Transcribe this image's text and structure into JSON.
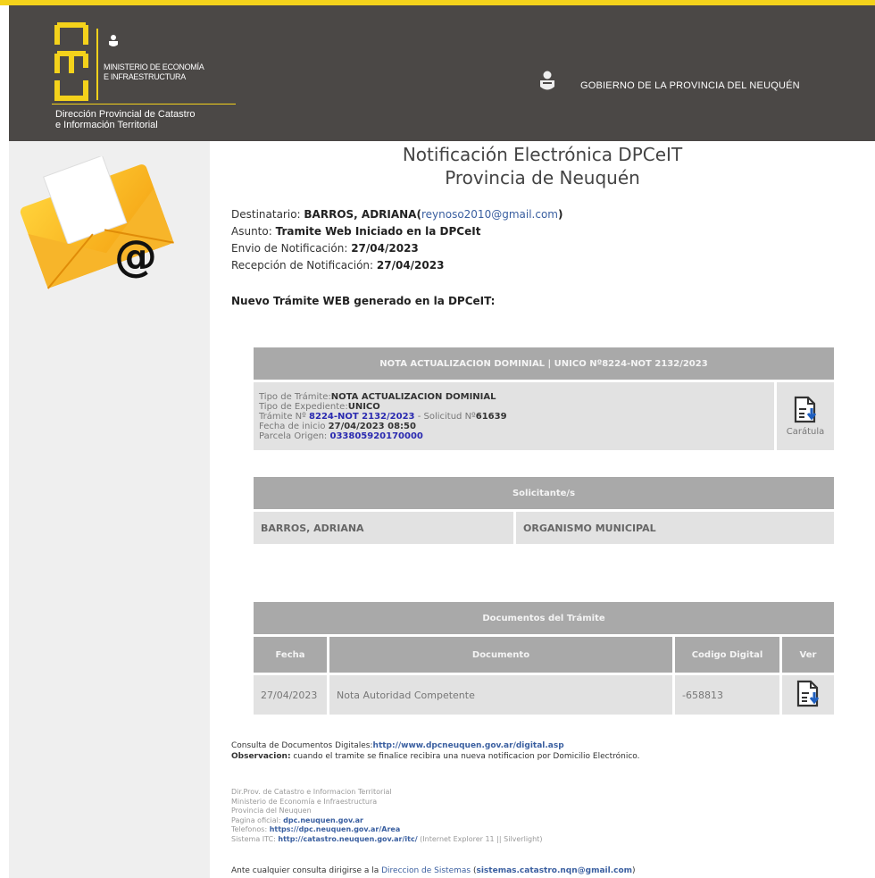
{
  "header": {
    "logo_text": "neu",
    "ministerio_line1": "MINISTERIO DE ECONOMÍA",
    "ministerio_line2": "E INFRAESTRUCTURA",
    "direccion_line1": "Dirección Provincial de Catastro",
    "direccion_line2": "e Información Territorial",
    "gobierno": "GOBIERNO DE LA PROVINCIA DEL NEUQUÉN"
  },
  "title": {
    "line1": "Notificación Electrónica DPCeIT",
    "line2": "Provincia de Neuquén"
  },
  "meta": {
    "destinatario_label": "Destinatario: ",
    "destinatario_value": "BARROS, ADRIANA",
    "destinatario_email": "reynoso2010@gmail.com",
    "asunto_label": "Asunto: ",
    "asunto_value": "Tramite Web Iniciado en la DPCeIt",
    "envio_label": "Envio de Notificación: ",
    "envio_value": "27/04/2023",
    "recepcion_label": "Recepción de Notificación: ",
    "recepcion_value": "27/04/2023"
  },
  "nuevo_tramite": "Nuevo Trámite WEB generado en la DPCeIT:",
  "tramite": {
    "header": "NOTA ACTUALIZACION DOMINIAL | UNICO Nº8224-NOT 2132/2023",
    "tipo_tramite_label": "Tipo de Trámite:",
    "tipo_tramite_value": "NOTA ACTUALIZACION DOMINIAL",
    "tipo_expediente_label": "Tipo de Expediente:",
    "tipo_expediente_value": "UNICO",
    "tramite_no_label": "Trámite Nº ",
    "tramite_no_value": "8224-NOT 2132/2023",
    "solicitud_label": " - Solicitud Nº",
    "solicitud_value": "61639",
    "fecha_inicio_label": "Fecha de inicio ",
    "fecha_inicio_value": "27/04/2023 08:50",
    "parcela_label": "Parcela Origen: ",
    "parcela_value": "033805920170000",
    "caratula_label": "Carátula"
  },
  "solicitante": {
    "header": "Solicitante/s",
    "nombre": "BARROS, ADRIANA",
    "organismo": "ORGANISMO MUNICIPAL"
  },
  "documentos": {
    "header": "Documentos del Trámite",
    "columns": [
      "Fecha",
      "Documento",
      "Codigo Digital",
      "Ver"
    ],
    "rows": [
      {
        "fecha": "27/04/2023",
        "documento": "Nota Autoridad Competente",
        "codigo": "-658813"
      }
    ]
  },
  "consulta": {
    "label": "Consulta de Documentos Digitales:",
    "url": "http://www.dpcneuquen.gov.ar/digital.asp",
    "obs_label": "Observacion:",
    "obs_text": " cuando el tramite se finalice recibira una nueva notificacion por Domicilio Electrónico."
  },
  "footer": {
    "line1": "Dir.Prov. de Catastro e Informacion Territorial",
    "line2": "Ministerio de Economía e Infraestructura",
    "line3": "Provincia del Neuquen",
    "pagina_label": "Pagina oficial: ",
    "pagina_value": "dpc.neuquen.gov.ar",
    "telefonos_label": "Telefonos: ",
    "telefonos_value": "https://dpc.neuquen.gov.ar/Area",
    "sistema_label": "Sistema ITC: ",
    "sistema_value": "http://catastro.neuquen.gov.ar/itc/",
    "sistema_note": " (Internet Explorer 11 || Silverlight)"
  },
  "ante": {
    "text": "Ante cualquier consulta dirigirse a la ",
    "link": "Direccion de Sistemas",
    "email": "sistemas.catastro.nqn@gmail.com"
  },
  "colors": {
    "accent_yellow": "#f4d21b",
    "header_bg": "#4b4846",
    "table_header": "#a9a9a9",
    "table_cell": "#e2e2e2",
    "link_blue": "#3a5fa0"
  }
}
